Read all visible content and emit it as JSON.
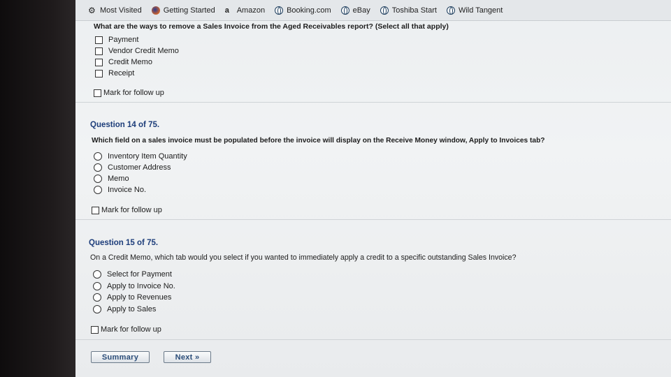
{
  "bookmarks": [
    {
      "label": "Most Visited",
      "icon": "gear-icon"
    },
    {
      "label": "Getting Started",
      "icon": "firefox-icon"
    },
    {
      "label": "Amazon",
      "icon": "amazon-icon"
    },
    {
      "label": "Booking.com",
      "icon": "globe-icon"
    },
    {
      "label": "eBay",
      "icon": "globe-icon"
    },
    {
      "label": "Toshiba Start",
      "icon": "globe-icon"
    },
    {
      "label": "Wild Tangent",
      "icon": "globe-icon"
    }
  ],
  "q13": {
    "text": "What are the ways to remove a Sales Invoice from the Aged Receivables report? (Select all that apply)",
    "options": [
      "Payment",
      "Vendor Credit Memo",
      "Credit Memo",
      "Receipt"
    ],
    "follow_up": "Mark for follow up"
  },
  "q14": {
    "title": "Question 14 of 75.",
    "text": "Which field on a sales invoice must be populated before the invoice will display on the Receive Money window, Apply to Invoices tab?",
    "options": [
      "Inventory Item Quantity",
      "Customer Address",
      "Memo",
      "Invoice No."
    ],
    "follow_up": "Mark for follow up"
  },
  "q15": {
    "title": "Question 15 of 75.",
    "text": "On a Credit Memo, which tab would you select if you wanted to immediately apply a credit to a specific outstanding Sales Invoice?",
    "options": [
      "Select for Payment",
      "Apply to Invoice No.",
      "Apply to Revenues",
      "Apply to Sales"
    ],
    "follow_up": "Mark for follow up"
  },
  "nav": {
    "summary": "Summary",
    "next": "Next »"
  }
}
